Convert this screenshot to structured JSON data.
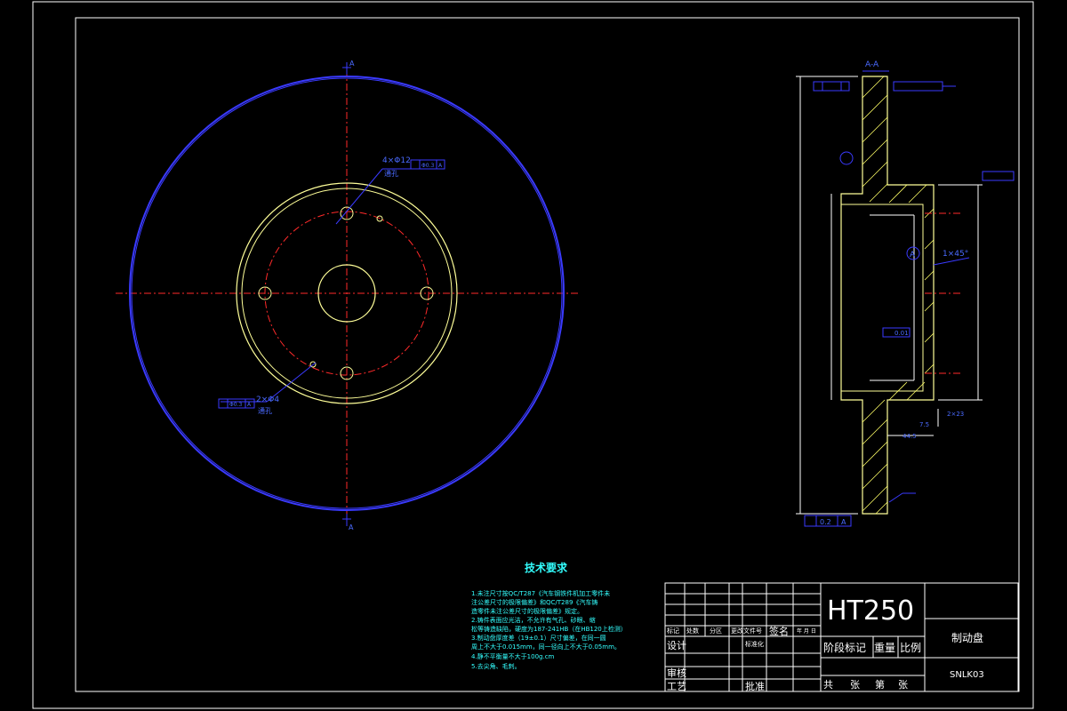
{
  "drawing": {
    "section_label": "A-A",
    "view_marks": {
      "top": "A",
      "bottom": "A"
    },
    "datum_label": "A",
    "callouts": {
      "holes_4x12": "4×Φ12",
      "holes_4x12_note": "通孔",
      "holes_2x4": "2×Φ4",
      "holes_2x4_note": "通孔",
      "tol_pos_1": "Φ0.3",
      "tol_pos_datum": "A",
      "chamfer": "1×45°",
      "runout_bottom": "0.2",
      "runout_bottom_datum": "A",
      "flatness": "0.01",
      "dim_2x23": "2×23",
      "dim_44": "44.5",
      "dim_7": "7.5"
    }
  },
  "tech_requirements": {
    "title": "技术要求",
    "lines": [
      "1.未注尺寸按QC/T287《汽车钢铁件机加工零件未",
      "注公差尺寸的极限偏差》和QC/T289《汽车铸",
      "造零件未注公差尺寸的极限偏差》规定。",
      "2.铸件表面应光洁，不允许有气孔、砂眼、缩",
      "松等铸造缺陷，硬度为187-241HB（在HB120上检测）",
      "3.制动盘厚度差（19±0.1）尺寸偏差，在同一圆",
      "周上不大于0.015mm，同一径向上不大于0.05mm。",
      "4.静不平衡量不大于100g.cm",
      "5.去尖角、毛刺。"
    ]
  },
  "title_block": {
    "material": "HT250",
    "part_name": "制动盘",
    "drawing_no": "SNLK03",
    "rev_headers": [
      "标记",
      "处数",
      "分区",
      "更改文件号",
      "签名",
      "年 月 日"
    ],
    "design": "设计",
    "standardize": "标准化",
    "review": "审核",
    "process": "工艺",
    "approve": "批准",
    "stage_mark": "阶段标记",
    "weight": "重量",
    "scale": "比例",
    "sheet_total": "共",
    "sheet_unit": "张",
    "sheet_no": "第",
    "sheet_unit2": "张"
  }
}
